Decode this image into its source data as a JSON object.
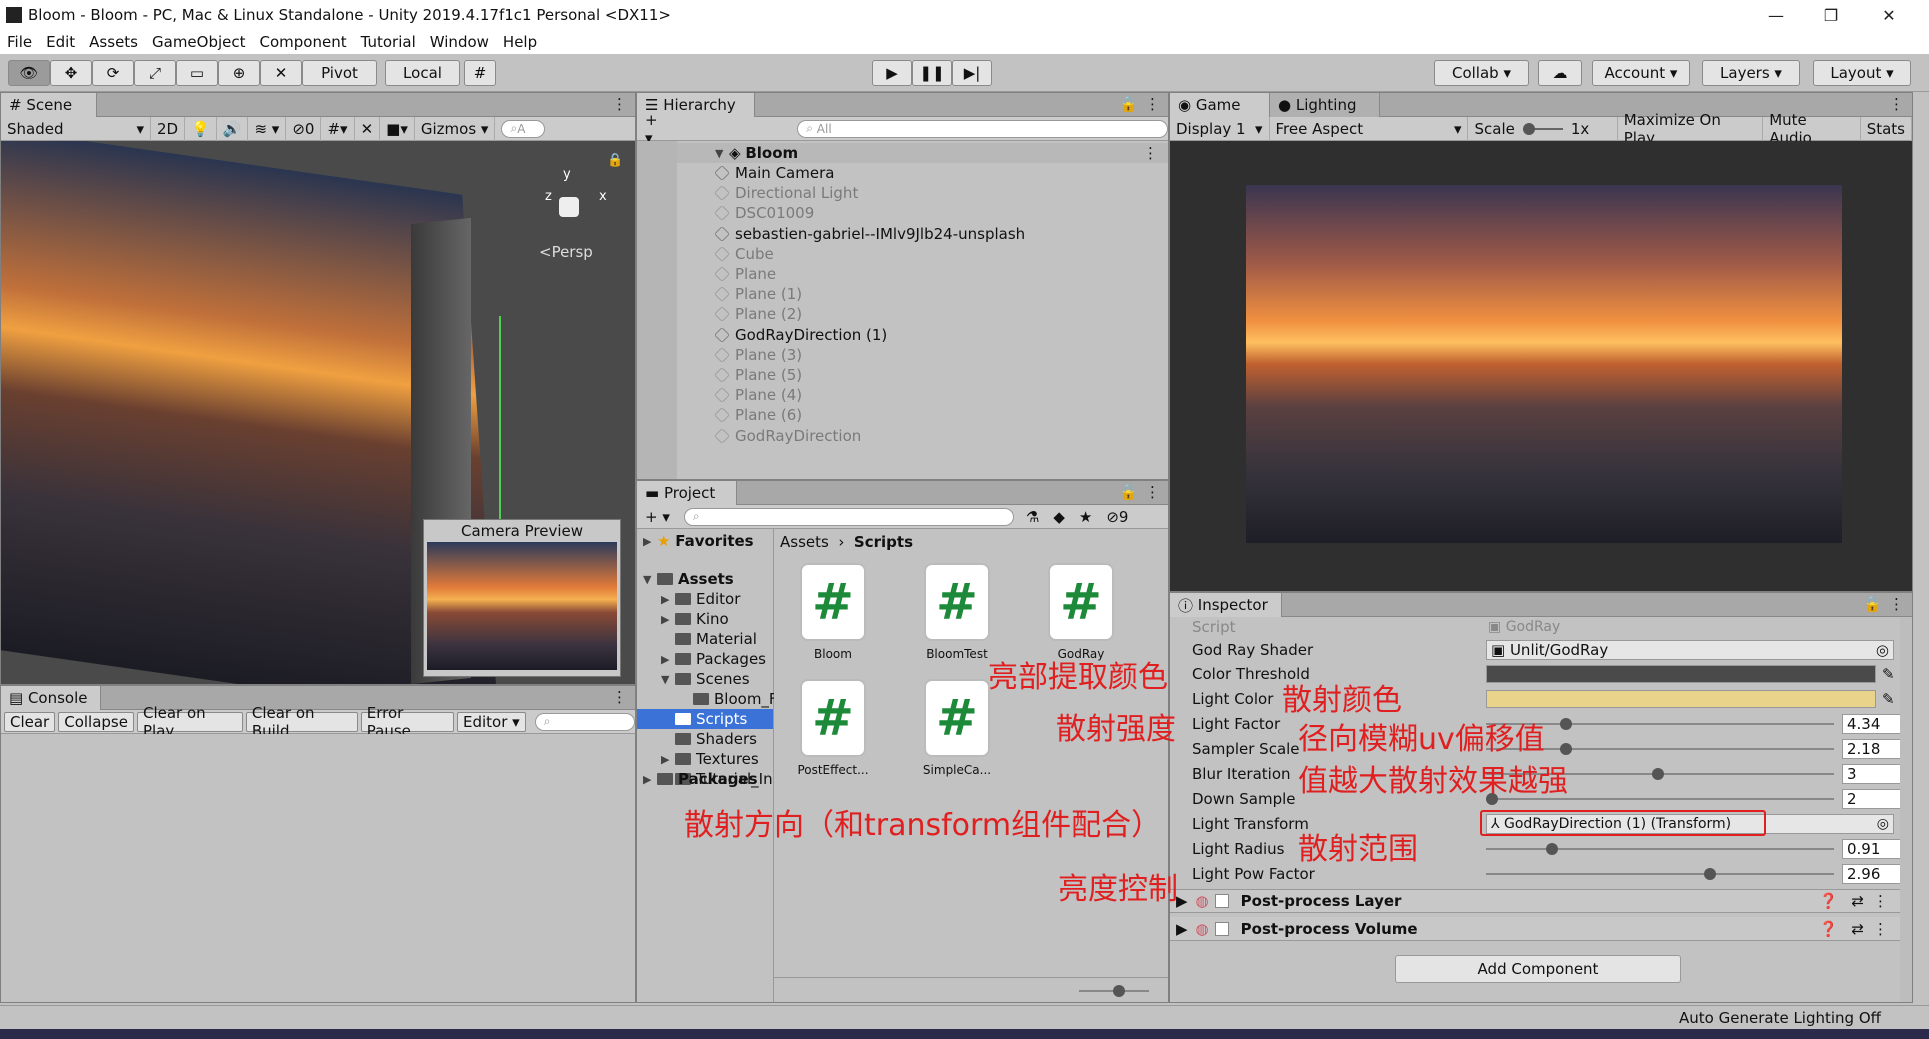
{
  "window": {
    "title": "Bloom - Bloom - PC, Mac & Linux Standalone - Unity 2019.4.17f1c1 Personal <DX11>",
    "minimize": "—",
    "restore": "❐",
    "close": "✕"
  },
  "menu": [
    "File",
    "Edit",
    "Assets",
    "GameObject",
    "Component",
    "Tutorial",
    "Window",
    "Help"
  ],
  "toolbar": {
    "pivot": "Pivot",
    "local": "Local",
    "collab": "Collab",
    "account": "Account",
    "layers": "Layers",
    "layout": "Layout"
  },
  "scene": {
    "tab": "Scene",
    "shading": "Shaded",
    "mode2d": "2D",
    "hidden_count": "0",
    "gizmos": "Gizmos",
    "search": "A",
    "persp": "<Persp",
    "axis_y": "y",
    "axis_x": "x",
    "axis_z": "z",
    "camera_preview": "Camera Preview"
  },
  "hierarchy": {
    "tab": "Hierarchy",
    "search": "All",
    "root": "Bloom",
    "items": [
      {
        "name": "Main Camera",
        "active": true
      },
      {
        "name": "Directional Light",
        "active": false
      },
      {
        "name": "DSC01009",
        "active": false
      },
      {
        "name": "sebastien-gabriel--IMlv9Jlb24-unsplash",
        "active": true
      },
      {
        "name": "Cube",
        "active": false
      },
      {
        "name": "Plane",
        "active": false
      },
      {
        "name": "Plane (1)",
        "active": false
      },
      {
        "name": "Plane (2)",
        "active": false
      },
      {
        "name": "GodRayDirection (1)",
        "active": true
      },
      {
        "name": "Plane (3)",
        "active": false
      },
      {
        "name": "Plane (5)",
        "active": false
      },
      {
        "name": "Plane (4)",
        "active": false
      },
      {
        "name": "Plane (6)",
        "active": false
      },
      {
        "name": "GodRayDirection",
        "active": false
      }
    ]
  },
  "project": {
    "tab": "Project",
    "hidden_count": "9",
    "favorites": "Favorites",
    "assets": "Assets",
    "packages": "Packages",
    "tree": [
      "Editor",
      "Kino",
      "Material",
      "Packages",
      "Scenes",
      "Bloom_F",
      "Scripts",
      "Shaders",
      "Textures",
      "Tutorial_In"
    ],
    "breadcrumb": [
      "Assets",
      "Scripts"
    ],
    "files": [
      "Bloom",
      "BloomTest",
      "GodRay",
      "PostEffect...",
      "SimpleCa..."
    ]
  },
  "console": {
    "tab": "Console",
    "buttons": [
      "Clear",
      "Collapse",
      "Clear on Play",
      "Clear on Build",
      "Error Pause",
      "Editor"
    ]
  },
  "game": {
    "tab": "Game",
    "lighting_tab": "Lighting",
    "display": "Display 1",
    "aspect": "Free Aspect",
    "scale_label": "Scale",
    "scale_value": "1x",
    "buttons": [
      "Maximize On Play",
      "Mute Audio",
      "Stats"
    ]
  },
  "inspector": {
    "tab": "Inspector",
    "script_label": "Script",
    "script_value": "GodRay",
    "shader_label": "God Ray Shader",
    "shader_value": "Unlit/GodRay",
    "color_threshold": "Color Threshold",
    "light_color": "Light Color",
    "light_factor": {
      "label": "Light Factor",
      "value": "4.34"
    },
    "sampler_scale": {
      "label": "Sampler Scale",
      "value": "2.18"
    },
    "blur_iteration": {
      "label": "Blur Iteration",
      "value": "3"
    },
    "down_sample": {
      "label": "Down Sample",
      "value": "2"
    },
    "light_transform": {
      "label": "Light Transform",
      "value": "GodRayDirection (1) (Transform)"
    },
    "light_radius": {
      "label": "Light Radius",
      "value": "0.91"
    },
    "light_pow": {
      "label": "Light Pow Factor",
      "value": "2.96"
    },
    "components": [
      "Post-process Layer",
      "Post-process Volume"
    ],
    "add_component": "Add Component"
  },
  "annotations": {
    "a1": "亮部提取颜色",
    "a2": "散射颜色",
    "a3": "散射强度",
    "a4": "径向模糊uv偏移值",
    "a5": "值越大散射效果越强",
    "a6": "散射方向（和transform组件配合）",
    "a7": "散射范围",
    "a8": "亮度控制"
  },
  "statusbar": "Auto Generate Lighting Off",
  "colors": {
    "accent_selection": "#3a72d8",
    "annotation": "#e02020",
    "light_color": "#e9d28a"
  }
}
